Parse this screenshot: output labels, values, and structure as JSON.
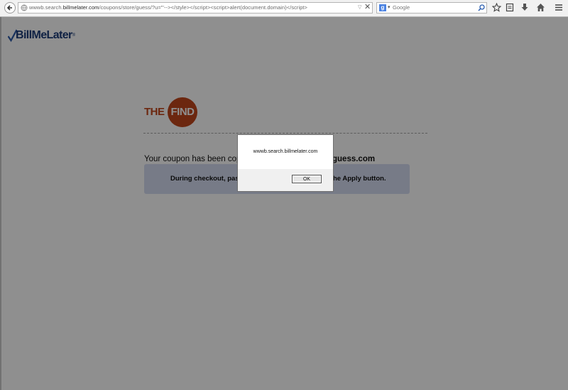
{
  "browser": {
    "url_prefix": "wwwb.search.",
    "url_domain": "billmelater.com",
    "url_path": "/coupons/store/guess/?u=\"'--></style></script><script>alert(document.domain)</script>",
    "search_engine_letter": "g",
    "search_placeholder": "Google",
    "clear_symbol": "✕",
    "dropdown_symbol": "▽"
  },
  "page": {
    "brand_logo_text": "BillMeLater",
    "brand_trademark": "®",
    "partner_logo_left": "THE",
    "partner_logo_right": "FIND",
    "coupon_message": "Your coupon has been copie",
    "coupon_store": "guess.com",
    "coupon_period": ".",
    "instruction_left": "During checkout, pas",
    "instruction_right": "he Apply button."
  },
  "dialog": {
    "message": "wwwb.search.billmelater.com",
    "ok_label": "OK"
  },
  "colors": {
    "brand_blue": "#1d3d7a",
    "partner_orange": "#c0461c",
    "instruction_bg": "#d5dcf0"
  }
}
